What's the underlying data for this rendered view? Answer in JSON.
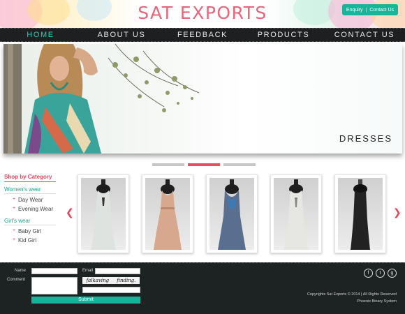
{
  "header": {
    "logo": "SAT EXPORTS",
    "enquiry_label": "Enquiry",
    "enquiry_separator": "|",
    "contact_label": "Contact Us"
  },
  "nav": {
    "items": [
      {
        "label": "HOME",
        "active": true
      },
      {
        "label": "ABOUT US",
        "active": false
      },
      {
        "label": "FEEDBACK",
        "active": false
      },
      {
        "label": "PRODUCTS",
        "active": false
      },
      {
        "label": "CONTACT US",
        "active": false
      }
    ]
  },
  "banner": {
    "caption": "DRESSES",
    "active_slide": 2,
    "slide_count": 3
  },
  "sidebar": {
    "title": "Shop by Category",
    "groups": [
      {
        "label": "Women's wear",
        "items": [
          "Day Wear",
          "Evening Wear"
        ]
      },
      {
        "label": "Girl's wear",
        "items": [
          "Baby Girl",
          "Kid Girl"
        ]
      }
    ]
  },
  "products": {
    "prev_icon": "chevron-left-icon",
    "next_icon": "chevron-right-icon",
    "items": [
      {
        "name": "dress-1",
        "color": "#dfe3df"
      },
      {
        "name": "dress-2",
        "color": "#d7a88e"
      },
      {
        "name": "dress-3",
        "color": "#5a6f8f"
      },
      {
        "name": "dress-4",
        "color": "#e6e6e2"
      },
      {
        "name": "dress-5",
        "color": "#222222"
      }
    ]
  },
  "footer": {
    "name_label": "Name",
    "email_label": "Email",
    "comment_label": "Comment",
    "captcha_words": [
      "falkaving",
      "finding."
    ],
    "submit_label": "Submit",
    "social_icons": [
      "facebook-icon",
      "twitter-icon",
      "google-plus-icon"
    ],
    "copyright": "Copyrights Sat Exports © 2014  |  All Rights Reserved",
    "powered_by": "Phoenix Binary System"
  },
  "colors": {
    "accent_pink": "#e6445c",
    "accent_teal": "#17b39a",
    "nav_bg": "#1d1f20",
    "footer_bg": "#1d2223"
  }
}
